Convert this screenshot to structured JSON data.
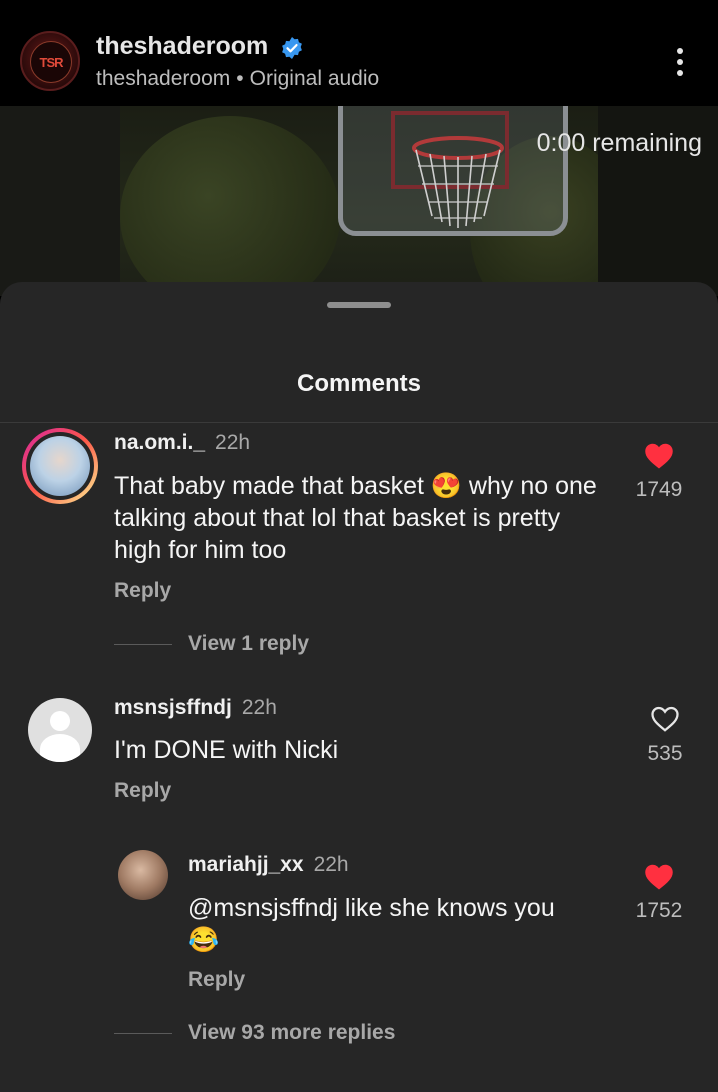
{
  "header": {
    "account_name": "theshaderoom",
    "audio_account": "theshaderoom",
    "separator": "•",
    "audio_label": "Original audio",
    "avatar_text": "TSR"
  },
  "video": {
    "remaining_label": "0:00 remaining"
  },
  "sheet": {
    "title": "Comments"
  },
  "comments": [
    {
      "username": "na.om.i._",
      "time": "22h",
      "text": "That baby made that basket 😍 why no one talking about that lol that basket is pretty high for him too",
      "reply_label": "Reply",
      "likes": "1749",
      "liked": true,
      "view_replies": "View 1 reply"
    },
    {
      "username": "msnsjsffndj",
      "time": "22h",
      "text": "I'm DONE with Nicki",
      "reply_label": "Reply",
      "likes": "535",
      "liked": false
    },
    {
      "username": "mariahjj_xx",
      "time": "22h",
      "text_mention": "@msnsjsffndj",
      "text": " like she knows you",
      "text_emoji": "😂",
      "reply_label": "Reply",
      "likes": "1752",
      "liked": true,
      "view_replies": "View 93 more replies"
    }
  ],
  "colors": {
    "heart_liked": "#ff3040",
    "sheet_bg": "#262626",
    "verified": "#3897f0"
  }
}
